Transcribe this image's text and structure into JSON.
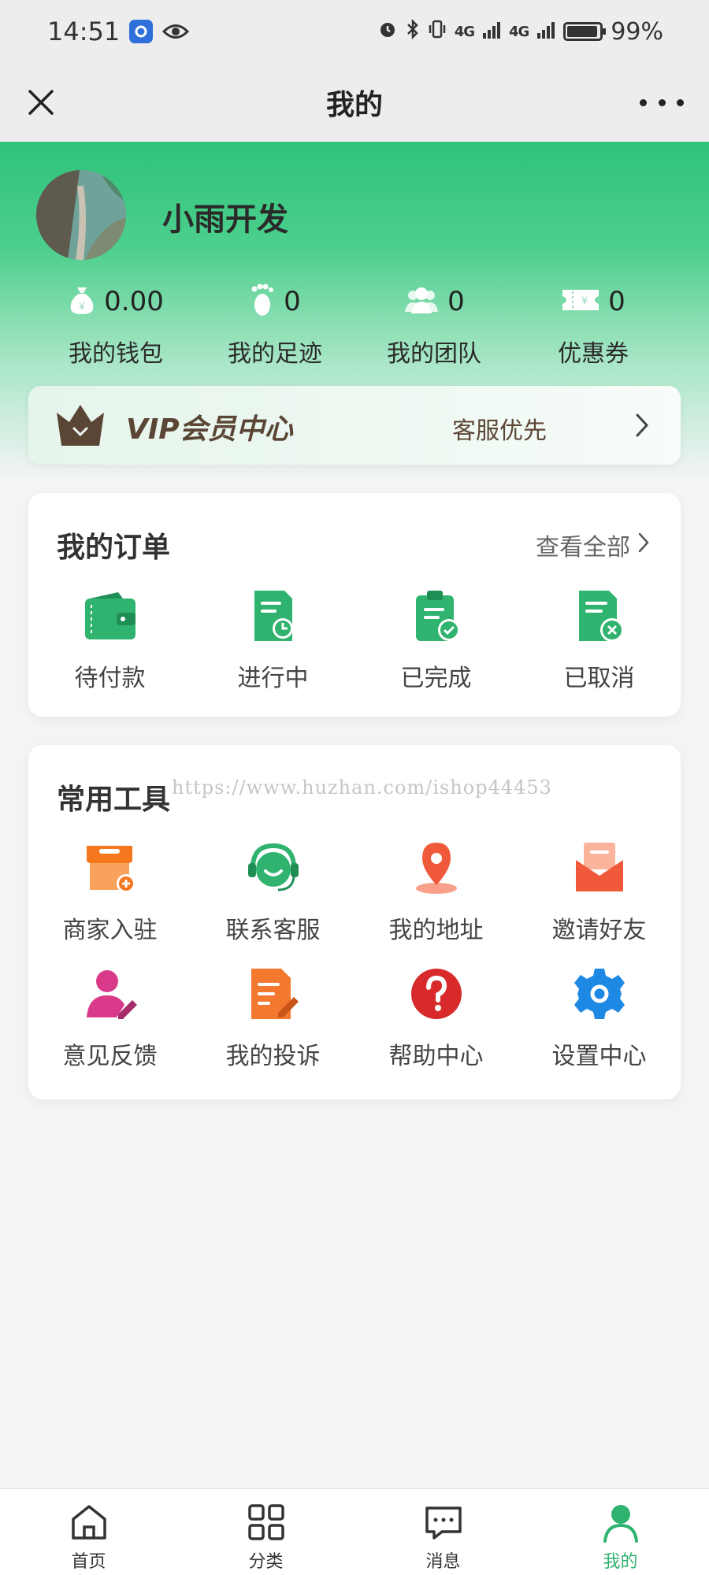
{
  "status_bar": {
    "time": "14:51",
    "battery": "99%",
    "network_1": "4G",
    "network_2": "4G"
  },
  "nav": {
    "title": "我的"
  },
  "profile": {
    "username": "小雨开发",
    "stats": [
      {
        "value": "0.00",
        "label": "我的钱包",
        "icon": "wallet-bag-icon"
      },
      {
        "value": "0",
        "label": "我的足迹",
        "icon": "footprint-icon"
      },
      {
        "value": "0",
        "label": "我的团队",
        "icon": "team-icon"
      },
      {
        "value": "0",
        "label": "优惠券",
        "icon": "coupon-icon"
      }
    ]
  },
  "vip": {
    "title": "VIP会员中心",
    "subtitle": "客服优先"
  },
  "orders": {
    "title": "我的订单",
    "view_all": "查看全部",
    "items": [
      {
        "label": "待付款",
        "icon": "wallet-icon"
      },
      {
        "label": "进行中",
        "icon": "document-clock-icon"
      },
      {
        "label": "已完成",
        "icon": "clipboard-check-icon"
      },
      {
        "label": "已取消",
        "icon": "document-cancel-icon"
      }
    ]
  },
  "tools": {
    "title": "常用工具",
    "items": [
      {
        "label": "商家入驻",
        "icon": "store-add-icon"
      },
      {
        "label": "联系客服",
        "icon": "headset-icon"
      },
      {
        "label": "我的地址",
        "icon": "location-pin-icon"
      },
      {
        "label": "邀请好友",
        "icon": "invite-envelope-icon"
      },
      {
        "label": "意见反馈",
        "icon": "user-edit-icon"
      },
      {
        "label": "我的投诉",
        "icon": "document-edit-icon"
      },
      {
        "label": "帮助中心",
        "icon": "help-icon"
      },
      {
        "label": "设置中心",
        "icon": "settings-gear-icon"
      }
    ]
  },
  "watermark": "https://www.huzhan.com/ishop44453",
  "tabbar": {
    "items": [
      {
        "label": "首页",
        "icon": "home-icon"
      },
      {
        "label": "分类",
        "icon": "category-grid-icon"
      },
      {
        "label": "消息",
        "icon": "message-icon"
      },
      {
        "label": "我的",
        "icon": "profile-icon",
        "active": true
      }
    ]
  },
  "colors": {
    "brand_green": "#2ec37a",
    "active_tab": "#2fb36f",
    "vip_text": "#5b4636"
  }
}
